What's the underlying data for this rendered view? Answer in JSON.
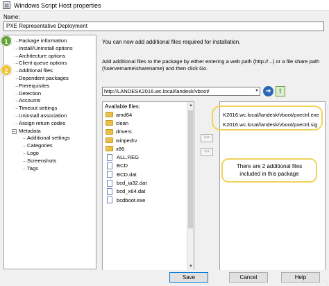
{
  "window": {
    "title": "Windows Script Host properties",
    "icon": "script-icon"
  },
  "name": {
    "label": "Name:",
    "value": "PXE Representative Deployment"
  },
  "tree": {
    "items": [
      {
        "label": "Package information",
        "level": 0
      },
      {
        "label": "Install/Uninstall options",
        "level": 0
      },
      {
        "label": "Architecture options",
        "level": 0
      },
      {
        "label": "Client queue options",
        "level": 0
      },
      {
        "label": "Additional files",
        "level": 0
      },
      {
        "label": "Dependent packages",
        "level": 0
      },
      {
        "label": "Prerequisites",
        "level": 0
      },
      {
        "label": "Detection",
        "level": 0
      },
      {
        "label": "Accounts",
        "level": 0
      },
      {
        "label": "Timeout settings",
        "level": 0
      },
      {
        "label": "Uninstall association",
        "level": 0
      },
      {
        "label": "Assign return codes",
        "level": 0
      },
      {
        "label": "Metadata",
        "level": 0
      },
      {
        "label": "Additional settings",
        "level": 1
      },
      {
        "label": "Categories",
        "level": 1
      },
      {
        "label": "Logo",
        "level": 1
      },
      {
        "label": "Screenshots",
        "level": 1
      },
      {
        "label": "Tags",
        "level": 1
      }
    ],
    "badges": [
      {
        "number": "1"
      },
      {
        "number": "2"
      }
    ]
  },
  "main": {
    "intro": "You can now add additional files required for installation.",
    "instruction_line1": "Add additional files to the package by either entering a web path (http://...) or a file share path",
    "instruction_line2": "(\\\\servername\\sharename) and then click Go.",
    "url_value": "http://LANDESK2016.wc.local/landesk/vboot/",
    "available_header": "Available files:",
    "available_files": [
      {
        "name": "amd64",
        "type": "folder"
      },
      {
        "name": "clean",
        "type": "folder"
      },
      {
        "name": "drivers",
        "type": "folder"
      },
      {
        "name": "winpedrv",
        "type": "folder"
      },
      {
        "name": "x86",
        "type": "folder"
      },
      {
        "name": "ALL.REG",
        "type": "file"
      },
      {
        "name": "BCD",
        "type": "file"
      },
      {
        "name": "BCD.dat",
        "type": "file"
      },
      {
        "name": "bcd_ia32.dat",
        "type": "file"
      },
      {
        "name": "bcd_x64.dat",
        "type": "file"
      },
      {
        "name": "bcdboot.exe",
        "type": "file"
      }
    ],
    "add_button": ">>",
    "remove_button": "<<",
    "selected_files": [
      "K2016.wc.local/landesk/vboot/pxectrl.exe",
      "K2016.wc.local/landesk/vboot/pxectrl.sig"
    ],
    "callout_line1": "There are 2 additional files",
    "callout_line2": "included in this package"
  },
  "buttons": {
    "save": "Save",
    "cancel": "Cancel",
    "help": "Help"
  },
  "colors": {
    "badge_green": "#63a53b",
    "badge_yellow": "#f2c230",
    "callout": "#f0d25c",
    "go_blue": "#2a68b5"
  }
}
